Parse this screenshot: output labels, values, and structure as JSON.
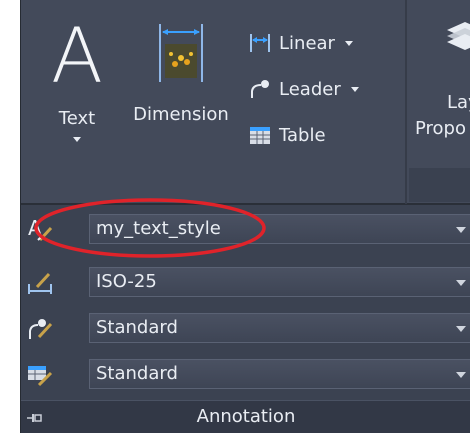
{
  "ribbon": {
    "text_button": {
      "glyph": "A",
      "label": "Text"
    },
    "dimension_button": {
      "label": "Dimension"
    },
    "linear_button": {
      "label": "Linear"
    },
    "leader_button": {
      "label": "Leader"
    },
    "table_button": {
      "label": "Table"
    },
    "layer_properties_button": {
      "label_line1": "Lay",
      "label_line2": "Propo"
    }
  },
  "style_combos": [
    {
      "name": "text-style",
      "value": "my_text_style",
      "icon": "text-style-icon"
    },
    {
      "name": "dimension-style",
      "value": "ISO-25",
      "icon": "dimension-style-icon"
    },
    {
      "name": "multileader-style",
      "value": "Standard",
      "icon": "multileader-style-icon"
    },
    {
      "name": "table-style",
      "value": "Standard",
      "icon": "table-style-icon"
    }
  ],
  "panel": {
    "title": "Annotation"
  },
  "colors": {
    "panel_bg": "#3b4251",
    "ribbon_bg": "#434a5a",
    "text": "#e9edf3",
    "highlight": "#e0232a",
    "accent_blue": "#3aa0ff"
  }
}
